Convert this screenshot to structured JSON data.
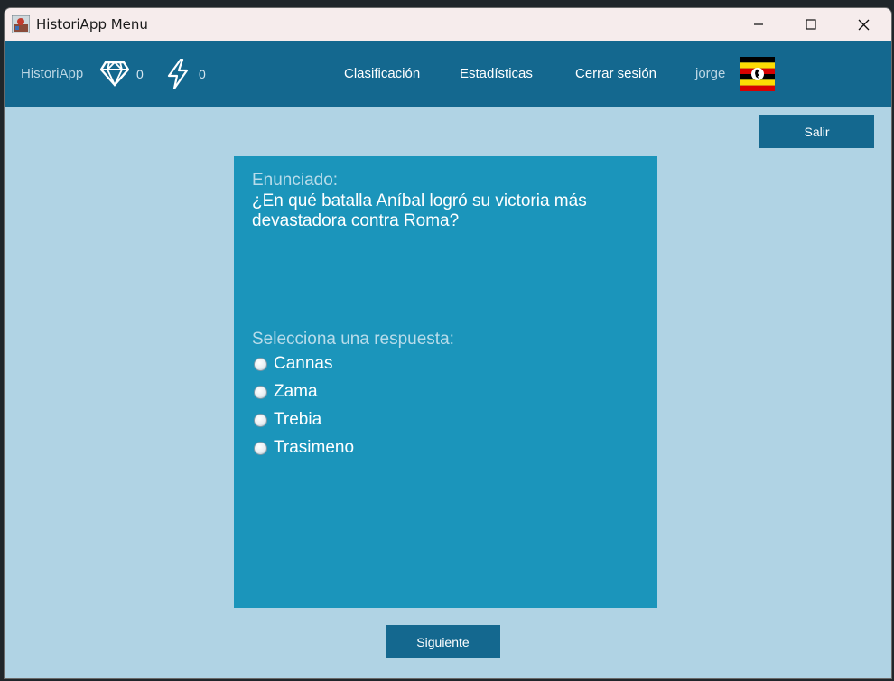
{
  "window": {
    "title": "HistoriApp Menu"
  },
  "navbar": {
    "brand": "HistoriApp",
    "gems_count": "0",
    "energy_count": "0",
    "links": {
      "ranking": "Clasificación",
      "stats": "Estadísticas",
      "logout": "Cerrar sesión"
    },
    "username": "jorge",
    "flag_icon": "uganda-flag-icon"
  },
  "actions": {
    "exit_label": "Salir",
    "next_label": "Siguiente"
  },
  "question": {
    "heading": "Enunciado:",
    "text": "¿En qué batalla Aníbal logró su victoria más devastadora contra Roma?",
    "prompt": "Selecciona una respuesta:",
    "options": [
      "Cannas",
      "Zama",
      "Trebia",
      "Trasimeno"
    ]
  },
  "colors": {
    "navbar": "#14688f",
    "background": "#b0d3e4",
    "card": "#1b95bb",
    "button": "#14688f"
  }
}
